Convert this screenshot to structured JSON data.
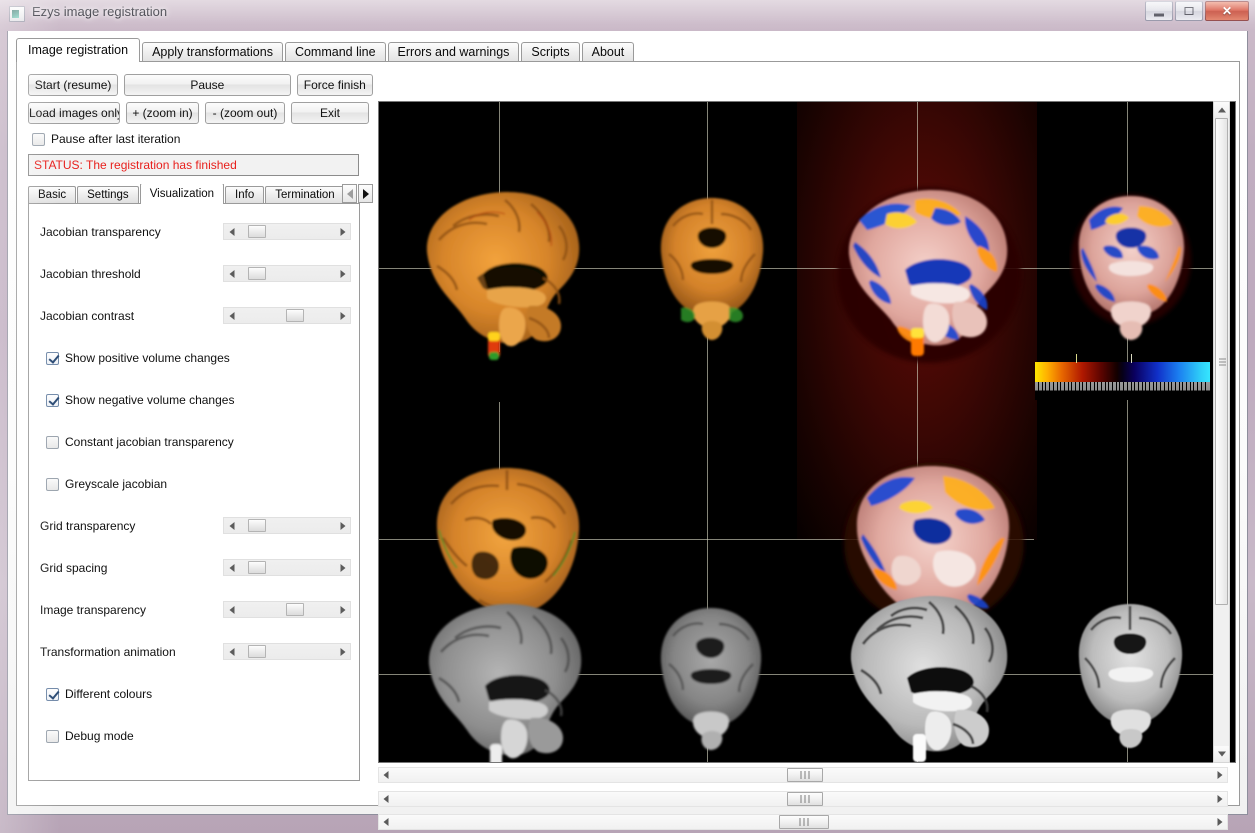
{
  "window": {
    "title": "Ezys image registration",
    "icon": "app-icon",
    "controls": {
      "minimize": "minimize-icon",
      "maximize": "maximize-icon",
      "close": "close-icon"
    }
  },
  "tabs": {
    "active": "Image registration",
    "items": [
      "Image registration",
      "Apply transformations",
      "Command line",
      "Errors and warnings",
      "Scripts",
      "About"
    ]
  },
  "controls": {
    "row1": [
      "Start (resume)",
      "Pause",
      "Force finish"
    ],
    "row2": [
      "Load images only",
      "+ (zoom in)",
      "- (zoom out)",
      "Exit"
    ],
    "pause_after_last_iteration": {
      "label": "Pause after last iteration",
      "checked": false
    },
    "status": {
      "text": "STATUS: The registration has finished",
      "color": "#e8201d"
    }
  },
  "inner_tabs": {
    "active": "Visualization",
    "items": [
      "Basic",
      "Settings",
      "Visualization",
      "Info",
      "Termination"
    ],
    "scroll_left": "scroll-left-icon",
    "scroll_right": "scroll-right-icon"
  },
  "visualization": {
    "rows": [
      {
        "kind": "slider",
        "label": "Jacobian transparency",
        "value": 10
      },
      {
        "kind": "slider",
        "label": "Jacobian threshold",
        "value": 10
      },
      {
        "kind": "slider",
        "label": "Jacobian contrast",
        "value": 50
      },
      {
        "kind": "checkbox",
        "label": "Show positive volume changes",
        "checked": true
      },
      {
        "kind": "checkbox",
        "label": "Show negative volume changes",
        "checked": true
      },
      {
        "kind": "checkbox",
        "label": "Constant jacobian transparency",
        "checked": false
      },
      {
        "kind": "checkbox",
        "label": "Greyscale jacobian",
        "checked": false
      },
      {
        "kind": "slider",
        "label": "Grid transparency",
        "value": 10
      },
      {
        "kind": "slider",
        "label": "Grid spacing",
        "value": 10
      },
      {
        "kind": "slider",
        "label": "Image transparency",
        "value": 50
      },
      {
        "kind": "slider",
        "label": "Transformation animation",
        "value": 10
      },
      {
        "kind": "checkbox",
        "label": "Different colours",
        "checked": true
      },
      {
        "kind": "checkbox",
        "label": "Debug mode",
        "checked": false
      }
    ]
  },
  "viewport": {
    "name": "brain-slice-viewport",
    "background": "#000000",
    "panels": [
      {
        "row": 1,
        "col": 1,
        "view": "sagittal",
        "style": "jacobian-orange"
      },
      {
        "row": 1,
        "col": 2,
        "view": "coronal",
        "style": "jacobian-orange"
      },
      {
        "row": 1,
        "col": 3,
        "view": "sagittal",
        "style": "jacobian-colour"
      },
      {
        "row": 1,
        "col": 4,
        "view": "coronal",
        "style": "jacobian-colour"
      },
      {
        "row": 2,
        "col": 1,
        "view": "axial",
        "style": "jacobian-orange"
      },
      {
        "row": 2,
        "col": 3,
        "view": "axial",
        "style": "jacobian-colour"
      },
      {
        "row": 3,
        "col": 1,
        "view": "sagittal",
        "style": "greyscale"
      },
      {
        "row": 3,
        "col": 2,
        "view": "coronal",
        "style": "greyscale"
      },
      {
        "row": 3,
        "col": 3,
        "view": "sagittal",
        "style": "greyscale"
      },
      {
        "row": 3,
        "col": 4,
        "view": "coronal",
        "style": "greyscale"
      }
    ],
    "colorbar": {
      "name": "jacobian-colorbar",
      "gradient_stops": [
        "#ffe600",
        "#e96a00",
        "#b01800",
        "#120000",
        "#1030c8",
        "#36e6ff"
      ]
    },
    "vertical_scrollbar": {
      "up": "scroll-up-icon",
      "down": "scroll-down-icon"
    },
    "horizontal_scrollbars": [
      {
        "name": "slice-scrollbar-x",
        "thumb_percent": 50
      },
      {
        "name": "slice-scrollbar-y",
        "thumb_percent": 50
      },
      {
        "name": "slice-scrollbar-z",
        "thumb_percent": 50
      }
    ]
  }
}
